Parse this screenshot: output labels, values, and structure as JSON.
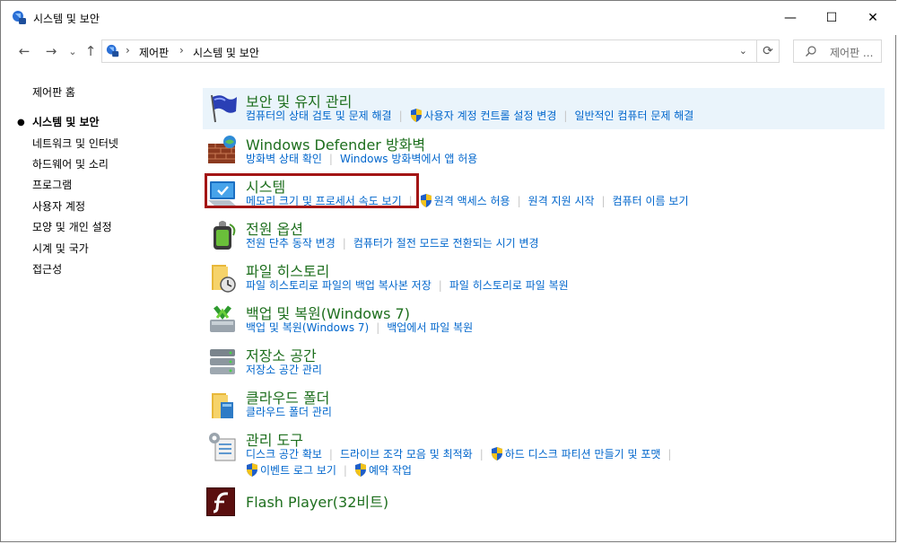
{
  "window": {
    "title": "시스템 및 보안",
    "minimize": "—",
    "maximize": "☐",
    "close": "✕"
  },
  "nav": {
    "back": "←",
    "forward": "→",
    "recent": "⌄",
    "up": "↑",
    "breadcrumb": [
      "제어판",
      "시스템 및 보안"
    ],
    "separator": "›",
    "dropdown": "⌄",
    "refresh": "⟳",
    "search_placeholder": "제어판 ..."
  },
  "sidebar": {
    "home": "제어판 홈",
    "items": [
      {
        "label": "시스템 및 보안",
        "current": true
      },
      {
        "label": "네트워크 및 인터넷"
      },
      {
        "label": "하드웨어 및 소리"
      },
      {
        "label": "프로그램"
      },
      {
        "label": "사용자 계정"
      },
      {
        "label": "모양 및 개인 설정"
      },
      {
        "label": "시계 및 국가"
      },
      {
        "label": "접근성"
      }
    ]
  },
  "categories": [
    {
      "title": "보안 및 유지 관리",
      "icon": "flag-icon",
      "links": [
        {
          "label": "컴퓨터의 상태 검토 및 문제 해결"
        },
        {
          "label": "사용자 계정 컨트롤 설정 변경",
          "shield": true
        },
        {
          "label": "일반적인 컴퓨터 문제 해결"
        }
      ]
    },
    {
      "title": "Windows Defender 방화벽",
      "icon": "firewall-icon",
      "links": [
        {
          "label": "방화벽 상태 확인"
        },
        {
          "label": "Windows 방화벽에서 앱 허용"
        }
      ]
    },
    {
      "title": "시스템",
      "icon": "system-icon",
      "links": [
        {
          "label": "메모리 크기 및 프로세서 속도 보기"
        },
        {
          "label": "원격 액세스 허용",
          "shield": true
        },
        {
          "label": "원격 지원 시작"
        },
        {
          "label": "컴퓨터 이름 보기"
        }
      ]
    },
    {
      "title": "전원 옵션",
      "icon": "power-icon",
      "links": [
        {
          "label": "전원 단추 동작 변경"
        },
        {
          "label": "컴퓨터가 절전 모드로 전환되는 시기 변경"
        }
      ]
    },
    {
      "title": "파일 히스토리",
      "icon": "file-history-icon",
      "links": [
        {
          "label": "파일 히스토리로 파일의 백업 복사본 저장"
        },
        {
          "label": "파일 히스토리로 파일 복원"
        }
      ]
    },
    {
      "title": "백업 및 복원(Windows 7)",
      "icon": "backup-icon",
      "links": [
        {
          "label": "백업 및 복원(Windows 7)"
        },
        {
          "label": "백업에서 파일 복원"
        }
      ]
    },
    {
      "title": "저장소 공간",
      "icon": "storage-icon",
      "links": [
        {
          "label": "저장소 공간 관리"
        }
      ]
    },
    {
      "title": "클라우드 폴더",
      "icon": "cloud-folder-icon",
      "links": [
        {
          "label": "클라우드 폴더 관리"
        }
      ]
    },
    {
      "title": "관리 도구",
      "icon": "admin-tools-icon",
      "links": [
        {
          "label": "디스크 공간 확보"
        },
        {
          "label": "드라이브 조각 모음 및 최적화"
        },
        {
          "label": "하드 디스크 파티션 만들기 및 포맷",
          "shield": true
        }
      ],
      "links2": [
        {
          "label": "이벤트 로그 보기",
          "shield": true
        },
        {
          "label": "예약 작업",
          "shield": true
        }
      ]
    },
    {
      "title": "Flash Player(32비트)",
      "icon": "flash-icon",
      "links": []
    }
  ],
  "colors": {
    "title_green": "#1e6f1e",
    "link_blue": "#0066cc",
    "highlight_bg": "#eaf4fb",
    "red_box": "#a31515"
  }
}
